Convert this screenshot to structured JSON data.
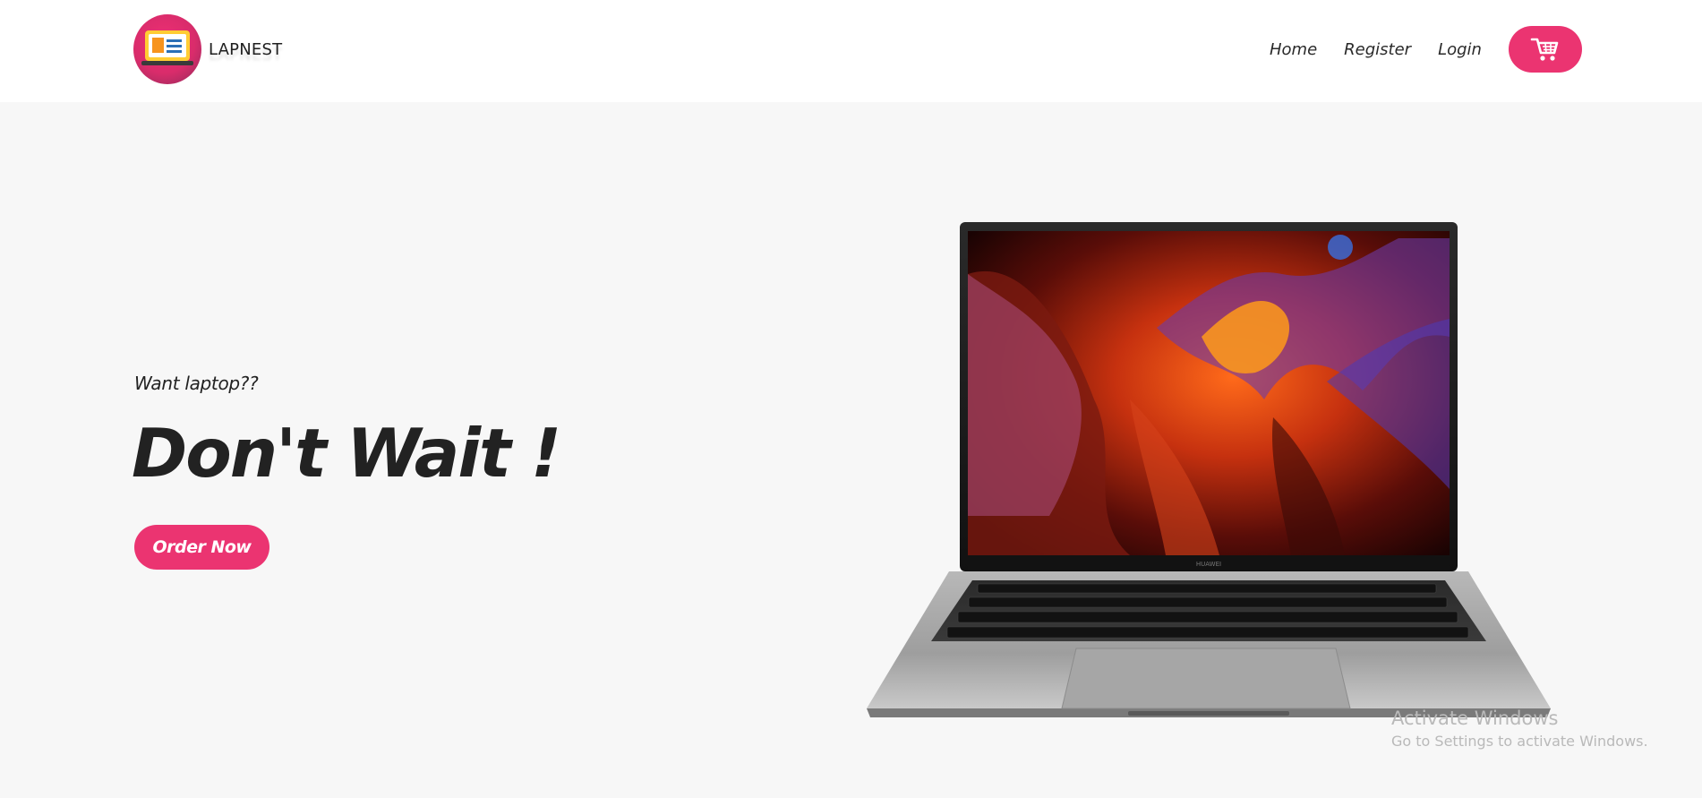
{
  "brand": {
    "name": "LAPNEST",
    "logo_icon": "laptop-logo-icon"
  },
  "nav": {
    "links": [
      {
        "label": "Home"
      },
      {
        "label": "Register"
      },
      {
        "label": "Login"
      }
    ],
    "cart_icon": "cart-icon"
  },
  "hero": {
    "pretitle": "Want laptop??",
    "title": "Don't Wait !",
    "cta_label": "Order Now",
    "product_image": "laptop-image"
  },
  "watermark": {
    "title": "Activate Windows",
    "subtitle": "Go to Settings to activate Windows."
  },
  "colors": {
    "accent": "#eb3471",
    "page_bg": "#f7f7f7",
    "header_bg": "#ffffff",
    "text": "#222222"
  }
}
